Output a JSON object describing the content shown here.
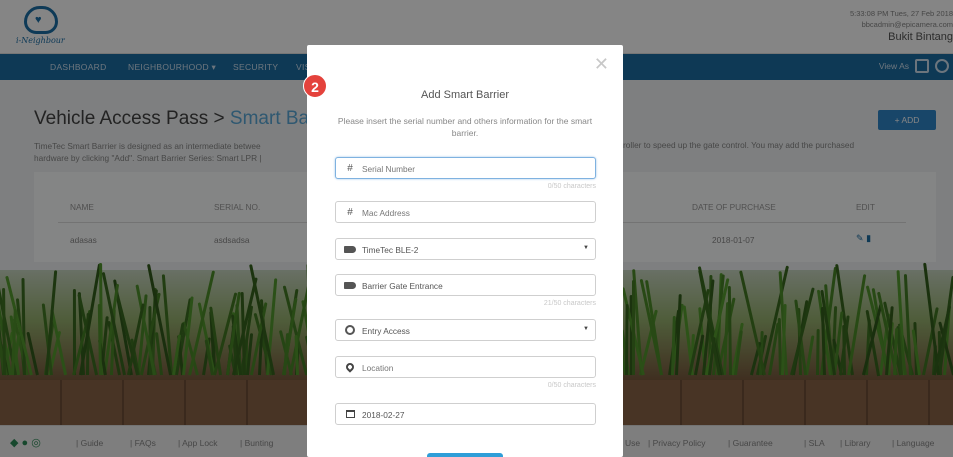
{
  "header": {
    "logo_text": "i-Neighbour",
    "datetime": "5:33:08 PM Tues, 27 Feb 2018",
    "email": "bbcadmin@epicamera.com",
    "location": "Bukit Bintang"
  },
  "nav": {
    "items": [
      "DASHBOARD",
      "NEIGHBOURHOOD ▾",
      "SECURITY",
      "VIS"
    ],
    "view_as": "View As"
  },
  "page": {
    "title_main": "Vehicle Access Pass > ",
    "title_sub": "Smart Barri",
    "description": "TimeTec Smart Barrier is designed as an intermediate betwee",
    "description_line2": "hardware by clicking \"Add\". Smart Barrier Series: Smart LPR |",
    "description_right": "roller to speed up the gate control. You may add the purchased",
    "add_button": "+ ADD"
  },
  "table": {
    "headers": {
      "name": "NAME",
      "serial": "SERIAL NO.",
      "date": "DATE OF PURCHASE",
      "edit": "EDIT"
    },
    "row": {
      "name": "adasas",
      "serial": "asdsadsa",
      "date": "2018-01-07"
    }
  },
  "footer": {
    "links_left": [
      "Guide",
      "FAQs",
      "App Lock",
      "Bunting"
    ],
    "links_right": [
      "Use",
      "Privacy Policy",
      "Guarantee",
      "SLA",
      "Library",
      "Language"
    ]
  },
  "modal": {
    "step": "2",
    "title": "Add Smart Barrier",
    "description": "Please insert the serial number and others information for the smart barrier.",
    "serial_placeholder": "Serial Number",
    "serial_counter": "0/50 characters",
    "mac_placeholder": "Mac Address",
    "model_value": "TimeTec BLE-2",
    "name_value": "Barrier Gate Entrance",
    "name_counter": "21/50 characters",
    "access_value": "Entry Access",
    "location_placeholder": "Location",
    "location_counter": "0/50 characters",
    "date_value": "2018-02-27"
  }
}
